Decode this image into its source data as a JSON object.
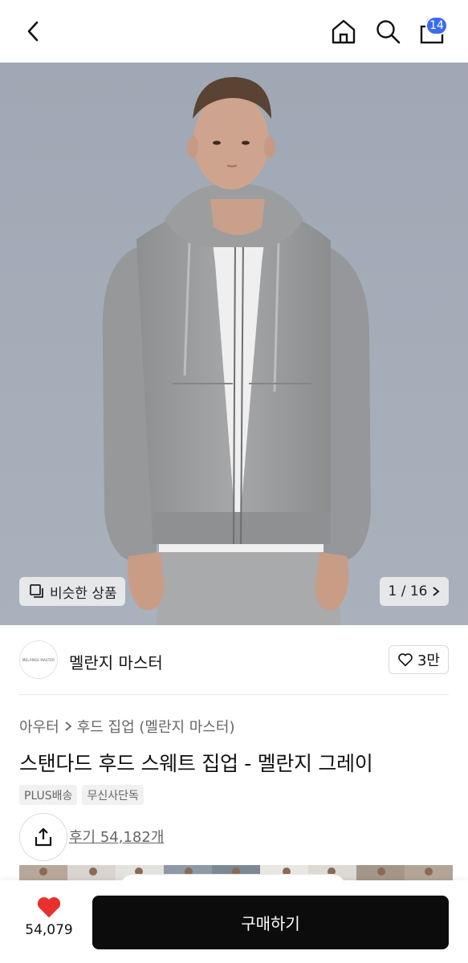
{
  "header": {
    "back_icon": "chevron-left-icon",
    "home_icon": "home-icon",
    "search_icon": "search-icon",
    "cart_icon": "shopping-bag-icon",
    "cart_badge": "14",
    "badge_color": "#3b6cf0"
  },
  "gallery": {
    "similar_label": "비슷한 상품",
    "current": "1",
    "total": "16",
    "pager_text": "1 / 16"
  },
  "brand": {
    "logo_text": "MELANGE MASTER",
    "name": "멜란지 마스터",
    "like_count": "3만"
  },
  "product": {
    "breadcrumb": [
      "아우터",
      "후드 집업 (멜란지 마스터)"
    ],
    "title": "스탠다드 후드 스웨트 집업 - 멜란지 그레이",
    "tags": [
      "PLUS배송",
      "무신사단독"
    ],
    "reviews": "후기 54,182개"
  },
  "bottom_bar": {
    "like_count": "54,079",
    "heart_color": "#e8312f",
    "buy_label": "구매하기"
  }
}
